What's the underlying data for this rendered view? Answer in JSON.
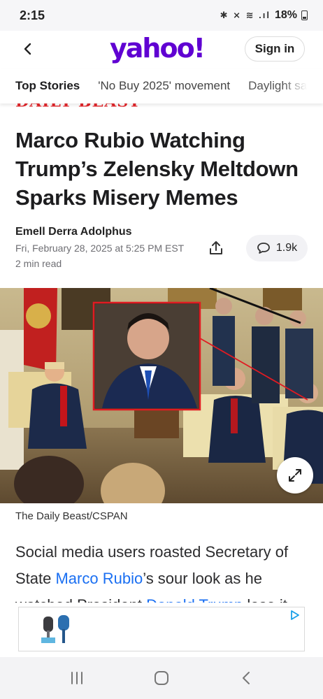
{
  "status_bar": {
    "time": "2:15",
    "icons": "✱ ⨯ ≋ .ıl",
    "battery": "18%"
  },
  "header": {
    "logo": "yahoo!",
    "sign_in": "Sign in",
    "brand_color": "#6001d2"
  },
  "tabs": [
    {
      "label": "Top Stories",
      "active": true
    },
    {
      "label": "'No Buy 2025' movement"
    },
    {
      "label": "Daylight sa"
    }
  ],
  "article": {
    "source": "DAILY BEAST",
    "title": "Marco Rubio Watching Trump’s Zelensky Meltdown Sparks Misery Memes",
    "author": "Emell Derra Adolphus",
    "date": "Fri, February 28, 2025 at 5:25 PM EST",
    "read_time": "2 min read",
    "comments": "1.9k",
    "caption": "The Daily Beast/CSPAN",
    "body": {
      "p1": "Social media users roasted Secretary of State ",
      "link1": "Marco Rubio",
      "p2": "’s sour look as he watched President ",
      "link2": "Donald Trump",
      "p3": " lose it"
    },
    "link_color": "#1a6ff2"
  },
  "icons": {
    "back": "chevron-left-icon",
    "share": "share-icon",
    "comment": "comment-icon",
    "expand": "expand-icon",
    "ad_choice": "ad-choices-icon",
    "nav_recents": "recents-icon",
    "nav_home": "home-icon",
    "nav_back": "back-icon"
  }
}
